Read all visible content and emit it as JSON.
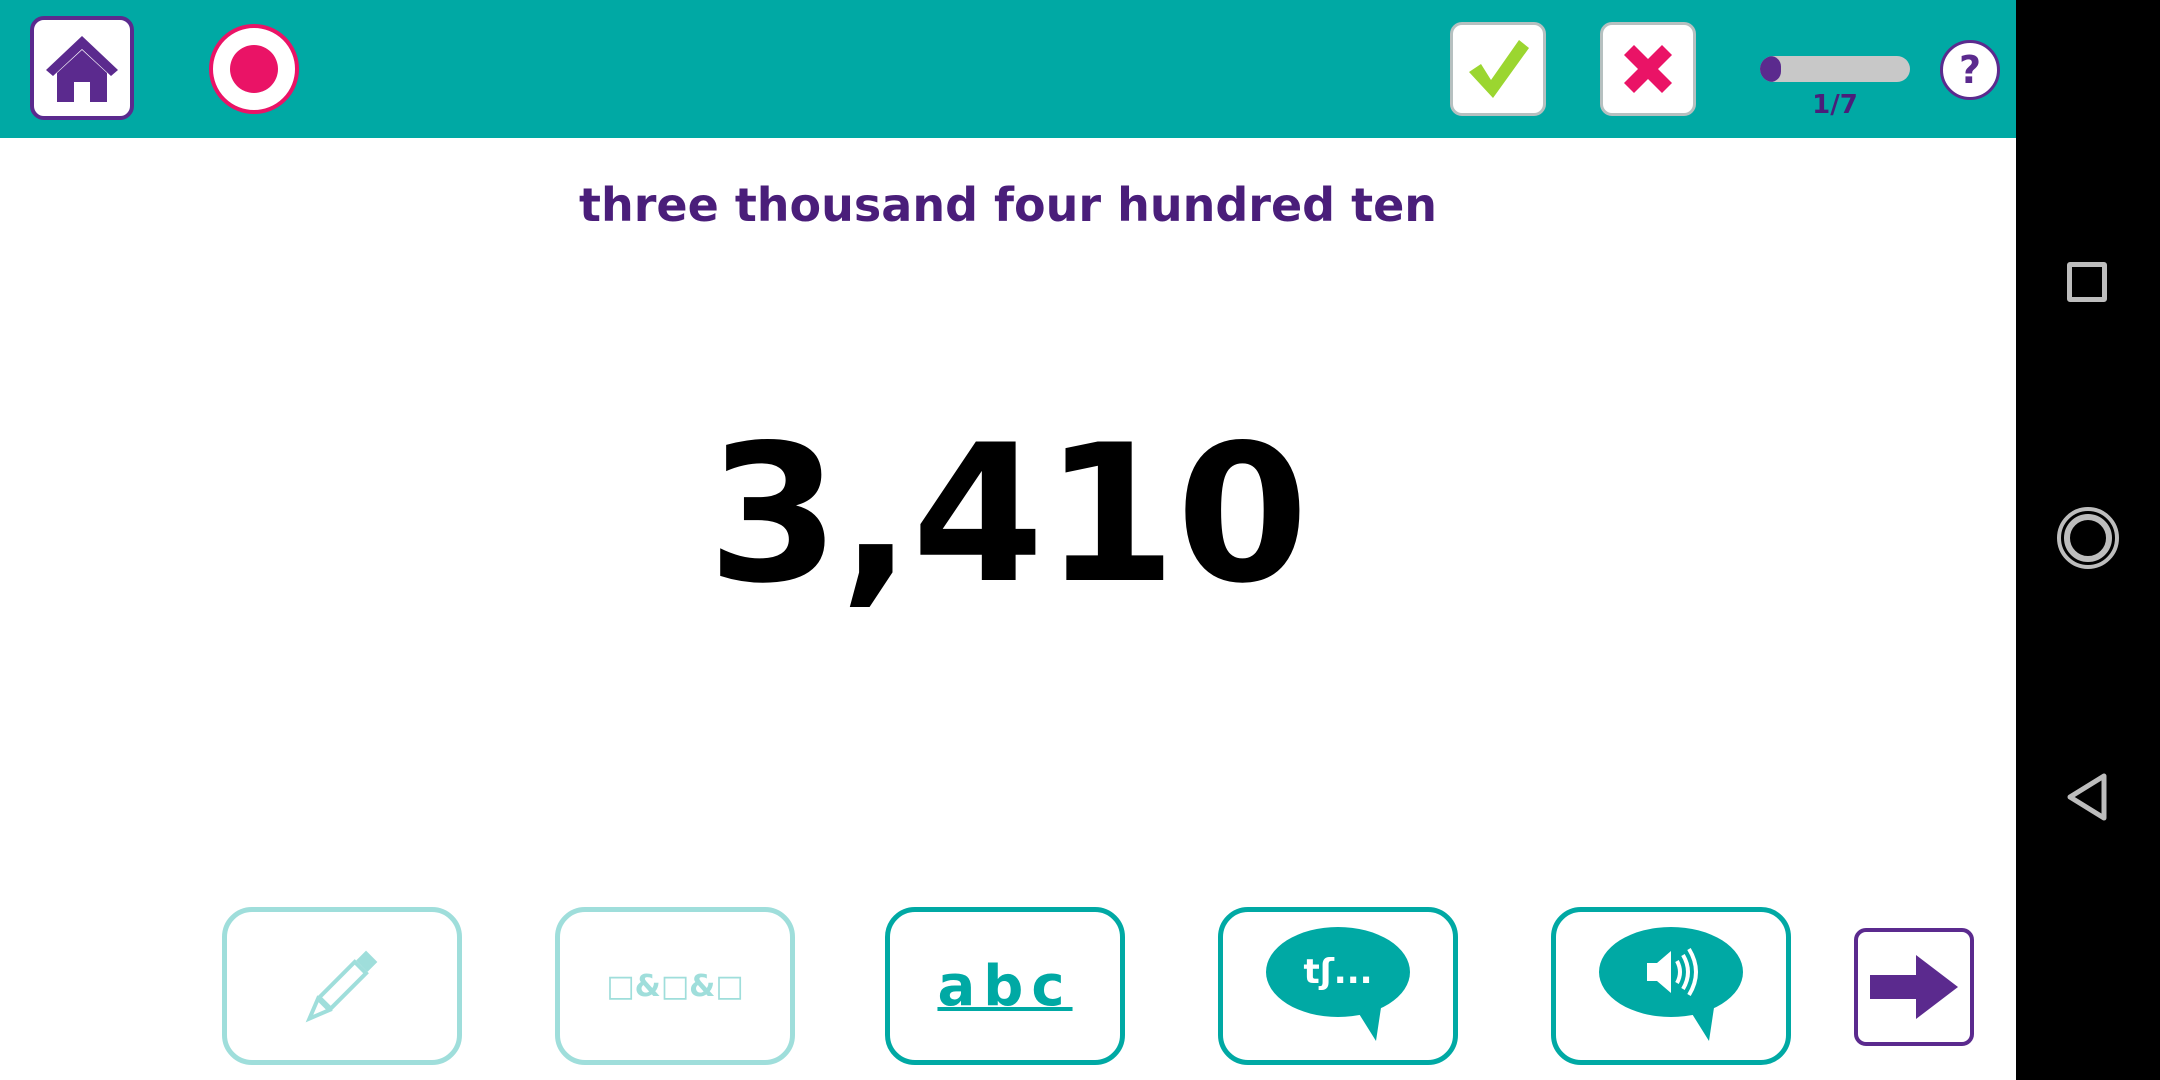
{
  "topbar": {
    "home_icon": "home-icon",
    "record_icon": "record-icon",
    "check_icon": "checkmark-icon",
    "cross_icon": "cross-icon",
    "progress": {
      "fraction": 0.14,
      "label": "1/7"
    },
    "help_label": "?"
  },
  "exercise": {
    "words": "three thousand four hundred ten",
    "number": "3,410"
  },
  "tools": {
    "pencil_icon": "pencil-icon",
    "boxes_label": "□&□&□",
    "abc_label": "abc",
    "phonetic_label": "tʃ...",
    "speaker_icon": "speaker-icon",
    "next_icon": "arrow-right-icon"
  },
  "colors": {
    "teal": "#00a9a4",
    "teal_disabled": "#9fdedb",
    "purple": "#5b2a8e",
    "pink": "#ea1366",
    "green": "#9bd630"
  },
  "android_nav": {
    "recents_icon": "square-icon",
    "home_icon": "circle-icon",
    "back_icon": "triangle-back-icon"
  }
}
